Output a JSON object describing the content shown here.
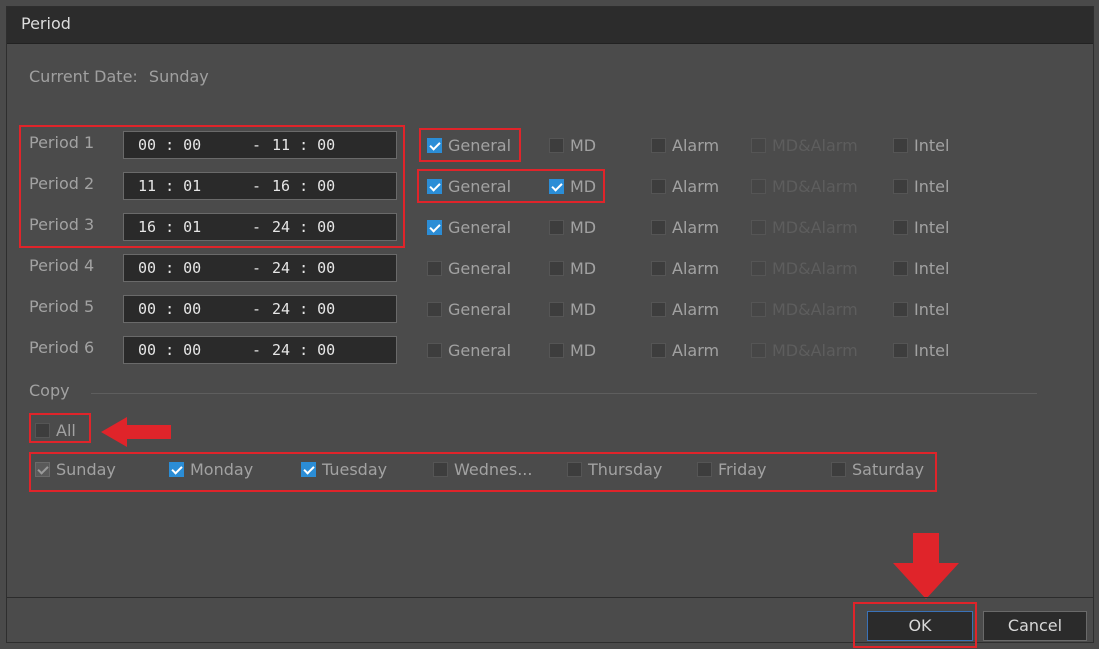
{
  "dialog": {
    "title": "Period"
  },
  "current_date": {
    "label": "Current Date:",
    "value": "Sunday"
  },
  "periods": [
    {
      "label": "Period 1",
      "start": "00 : 00",
      "end": "11 : 00",
      "general": true,
      "md": false
    },
    {
      "label": "Period 2",
      "start": "11 : 01",
      "end": "16 : 00",
      "general": true,
      "md": true
    },
    {
      "label": "Period 3",
      "start": "16 : 01",
      "end": "24 : 00",
      "general": true,
      "md": false
    },
    {
      "label": "Period 4",
      "start": "00 : 00",
      "end": "24 : 00",
      "general": false,
      "md": false
    },
    {
      "label": "Period 5",
      "start": "00 : 00",
      "end": "24 : 00",
      "general": false,
      "md": false
    },
    {
      "label": "Period 6",
      "start": "00 : 00",
      "end": "24 : 00",
      "general": false,
      "md": false
    }
  ],
  "time_separator": "-",
  "event_types": {
    "general": "General",
    "md": "MD",
    "alarm": "Alarm",
    "md_alarm": "MD&Alarm",
    "intel": "Intel"
  },
  "copy": {
    "label": "Copy",
    "all_label": "All",
    "days": [
      {
        "label": "Sunday",
        "state": "locked"
      },
      {
        "label": "Monday",
        "state": "checked"
      },
      {
        "label": "Tuesday",
        "state": "checked"
      },
      {
        "label": "Wednes...",
        "state": "unchecked"
      },
      {
        "label": "Thursday",
        "state": "unchecked"
      },
      {
        "label": "Friday",
        "state": "unchecked"
      },
      {
        "label": "Saturday",
        "state": "unchecked"
      }
    ]
  },
  "buttons": {
    "ok": "OK",
    "cancel": "Cancel"
  },
  "colors": {
    "highlight": "#e0242a",
    "check_blue": "#2b8dd6",
    "background": "#4b4b4b",
    "titlebar": "#2c2c2c"
  }
}
